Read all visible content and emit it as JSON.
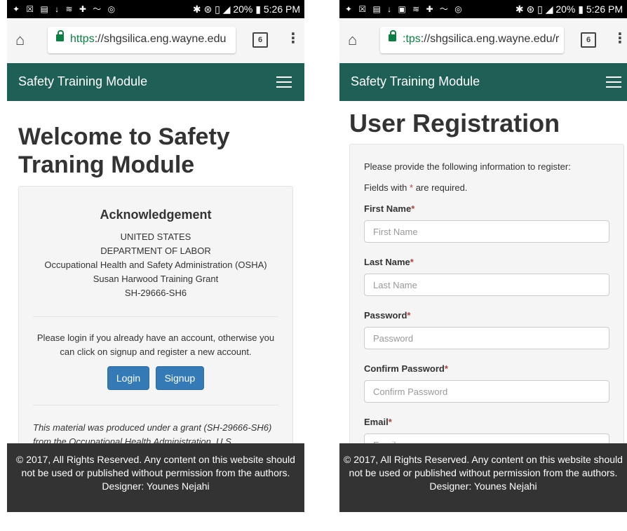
{
  "left_phone": {
    "status": {
      "icons": "✦ ☒ ▤ ↓ ≋ ✚ 〜 ◎",
      "right": "✱ ⊛ ▯ ◢ 20% ▮ 5:26 PM"
    },
    "url": {
      "scheme": "https",
      "rest": "://shgsilica.eng.wayne.edu",
      "tab_count": "6"
    },
    "navbar": {
      "brand": "Safety Training Module"
    },
    "title": "Welcome to Safety Traning Module",
    "ack": {
      "heading": "Acknowledgement",
      "lines": [
        "UNITED STATES",
        "DEPARTMENT OF LABOR",
        "Occupational Health and Safety Administration (OSHA)",
        "Susan Harwood Training Grant",
        "SH-29666-SH6"
      ]
    },
    "login_text": "Please login if you already have an account, otherwise you can click on signup and register a new account.",
    "login_label": "Login",
    "signup_label": "Signup",
    "grant_text": "This material was produced under a grant (SH-29666-SH6) from the Occupational Health Administration, U.S."
  },
  "right_phone": {
    "status": {
      "icons": "✦ ☒ ▤ ↓ ▣ ≋ ✚ 〜 ◎",
      "right": "✱ ⊛ ▯ ◢ 20% ▮ 5:26 PM"
    },
    "url": {
      "scheme": ":tps",
      "rest": "://shgsilica.eng.wayne.edu/r",
      "tab_count": "6"
    },
    "navbar": {
      "brand": "Safety Training Module"
    },
    "title": "User Registration",
    "intro": "Please provide the following information to register:",
    "required_note_pre": "Fields with ",
    "required_star": "*",
    "required_note_post": " are required.",
    "fields": [
      {
        "label": "First Name",
        "placeholder": "First Name"
      },
      {
        "label": "Last Name",
        "placeholder": "Last Name"
      },
      {
        "label": "Password",
        "placeholder": "Password"
      },
      {
        "label": "Confirm Password",
        "placeholder": "Confirm Password"
      },
      {
        "label": "Email",
        "placeholder": "Email"
      }
    ]
  },
  "footer": {
    "copyright": "© 2017, All Rights Reserved. Any content on this website should not be used or published without permission from the authors.",
    "designer": "Designer: Younes Nejahi"
  },
  "colors": {
    "navbar": "#1e5f56",
    "button": "#337ab7",
    "footer": "#333333",
    "required": "#a94442"
  }
}
